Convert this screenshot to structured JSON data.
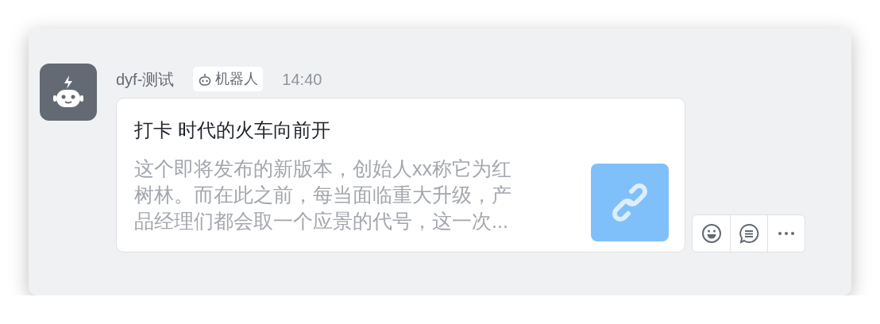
{
  "message": {
    "sender": "dyf-测试",
    "badge": "机器人",
    "time": "14:40",
    "card": {
      "title": "打卡 时代的火车向前开",
      "description": "这个即将发布的新版本，创始人xx称它为红树林。而在此之前，每当面临重大升级，产品经理们都会取一个应景的代号，这一次..."
    },
    "actions": [
      {
        "kind": "emoji"
      },
      {
        "kind": "reply"
      },
      {
        "kind": "more"
      }
    ]
  }
}
